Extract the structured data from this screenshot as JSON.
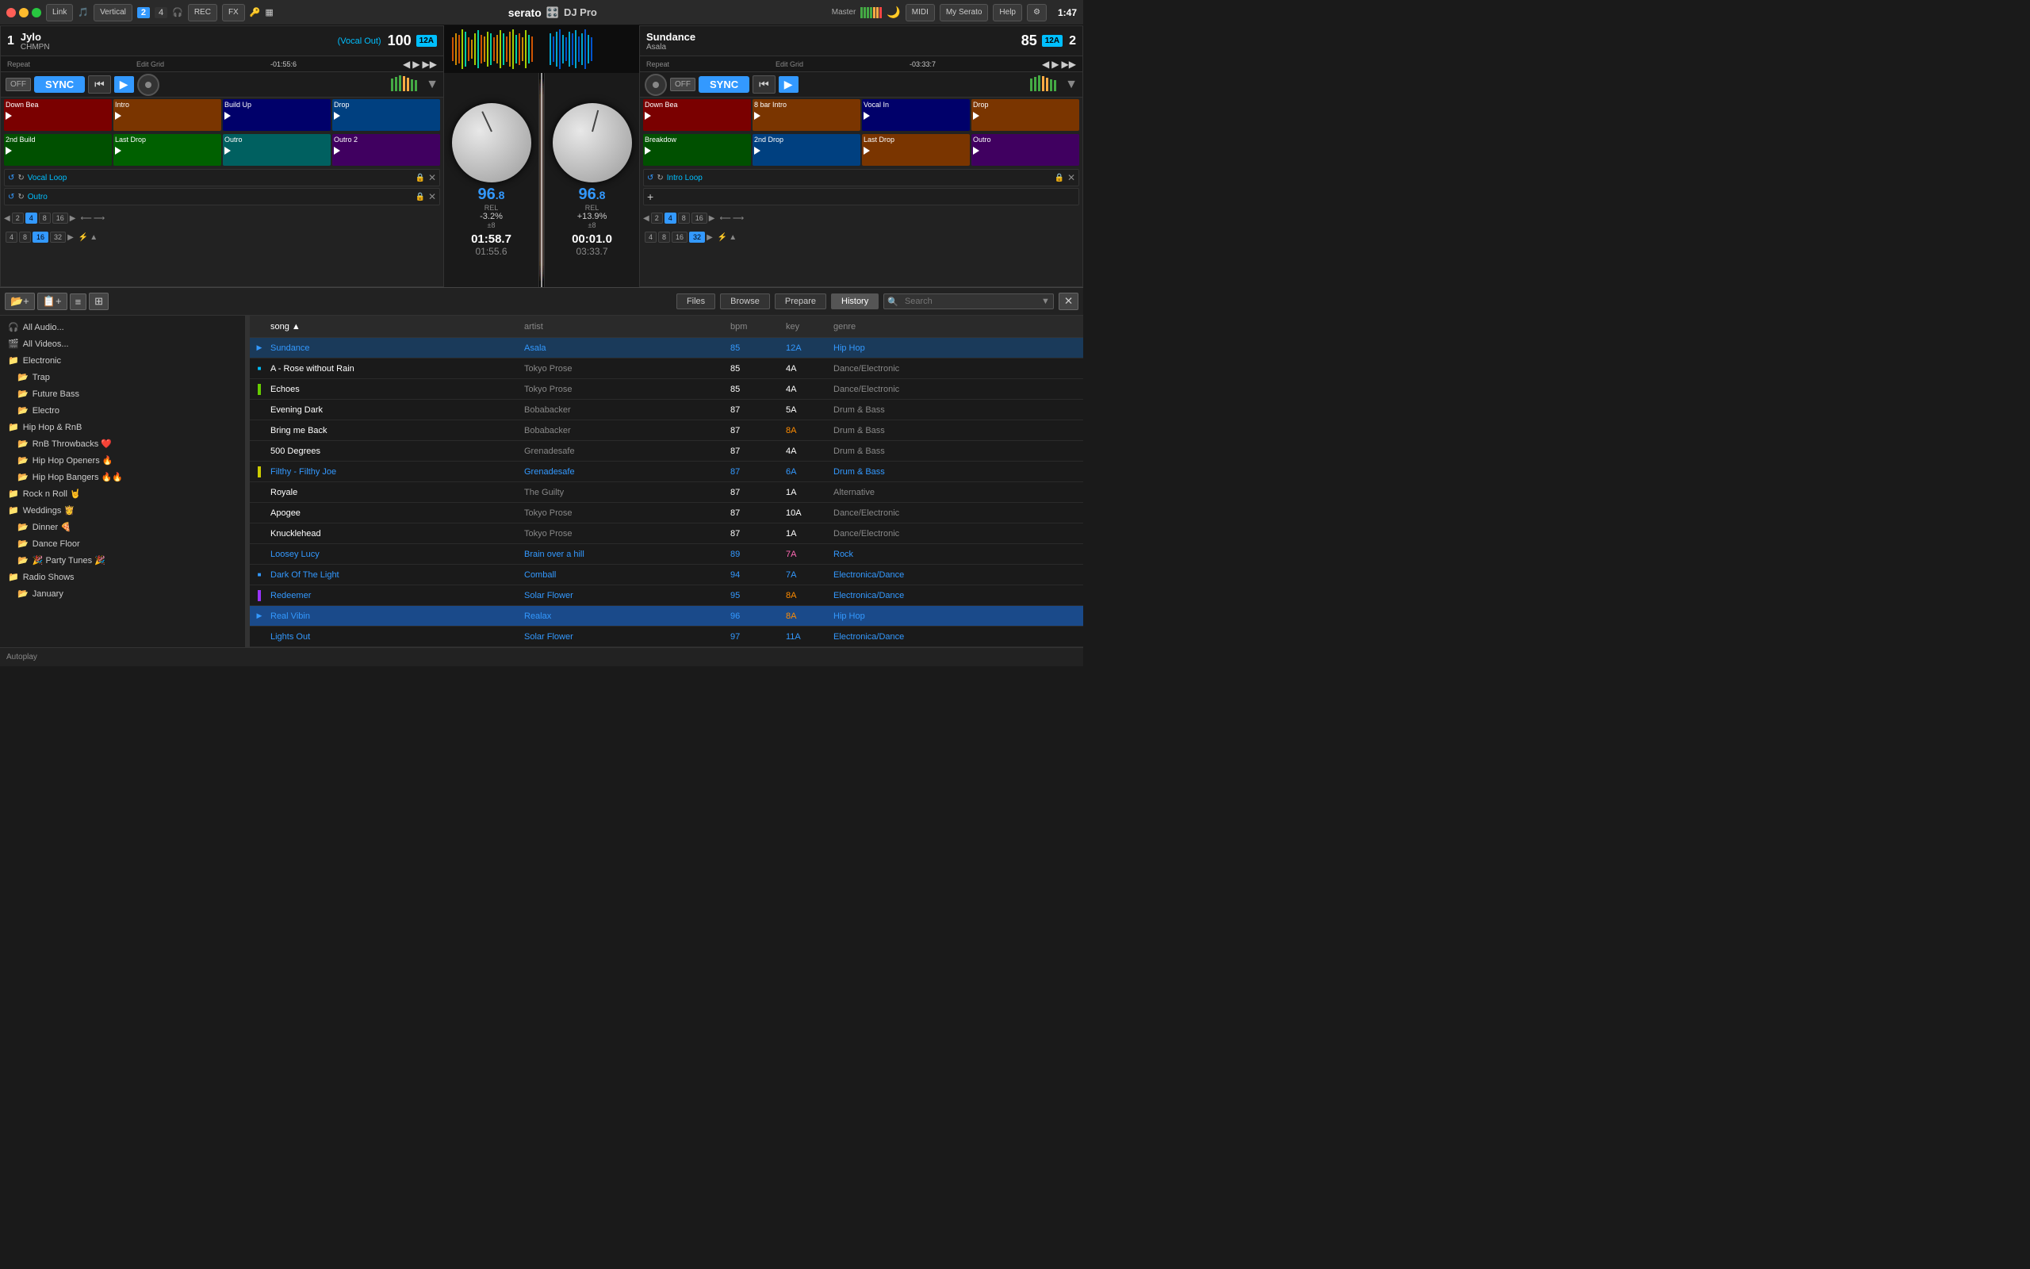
{
  "topbar": {
    "link_label": "Link",
    "vertical_label": "Vertical",
    "rec_label": "REC",
    "fx_label": "FX",
    "serato_brand": "serato",
    "dj_pro": "DJ Pro",
    "master_label": "Master",
    "midi_label": "MIDI",
    "my_serato_label": "My Serato",
    "help_label": "Help",
    "time": "1:47"
  },
  "deck1": {
    "number": "1",
    "title": "Jylo",
    "artist": "CHMPN",
    "vocal_tag": "(Vocal Out)",
    "bpm": "100",
    "key": "12A",
    "repeat_label": "Repeat",
    "edit_grid_label": "Edit Grid",
    "time_elapsed": "-01:55:6",
    "bpm_big": "96",
    "bpm_decimal": ".8",
    "bpm_rel": "REL",
    "pitch_pct": "-3.2%",
    "pitch_range": "±8",
    "time_remaining": "01:58.7",
    "time_total": "01:55.6",
    "off_label": "OFF",
    "sync_label": "SYNC",
    "cues": [
      {
        "label": "Down Bea",
        "color": "red"
      },
      {
        "label": "Intro",
        "color": "orange"
      },
      {
        "label": "Build Up",
        "color": "blue"
      },
      {
        "label": "Drop",
        "color": "blue"
      }
    ],
    "cues2": [
      {
        "label": "2nd Build",
        "color": "green"
      },
      {
        "label": "Last Drop",
        "color": "green"
      },
      {
        "label": "Outro",
        "color": "teal"
      },
      {
        "label": "Outro 2",
        "color": "purple"
      }
    ],
    "loop1_label": "Vocal Loop",
    "loop2_label": "Outro",
    "beat_vals": [
      "2",
      "4",
      "8",
      "16"
    ],
    "beat_vals2": [
      "4",
      "8",
      "16",
      "32"
    ],
    "active_beat": "4",
    "active_beat2": "16"
  },
  "deck2": {
    "number": "2",
    "title": "Sundance",
    "artist": "Asala",
    "bpm": "85",
    "key": "12A",
    "repeat_label": "Repeat",
    "edit_grid_label": "Edit Grid",
    "time_elapsed": "-03:33:7",
    "bpm_big": "96",
    "bpm_decimal": ".8",
    "bpm_rel": "REL",
    "pitch_pct": "+13.9%",
    "pitch_range": "±8",
    "time_remaining": "00:01.0",
    "time_total": "03:33.7",
    "off_label": "OFF",
    "sync_label": "SYNC",
    "cues": [
      {
        "label": "Down Bea",
        "color": "red"
      },
      {
        "label": "8 bar Intro",
        "color": "orange"
      },
      {
        "label": "Vocal In",
        "color": "blue"
      },
      {
        "label": "Drop",
        "color": "orange"
      }
    ],
    "cues2": [
      {
        "label": "Breakdow",
        "color": "green"
      },
      {
        "label": "2nd Drop",
        "color": "blue"
      },
      {
        "label": "Last Drop",
        "color": "orange"
      },
      {
        "label": "Outro",
        "color": "purple"
      }
    ],
    "loop1_label": "Intro Loop",
    "beat_vals": [
      "2",
      "4",
      "8",
      "16"
    ],
    "beat_vals2": [
      "4",
      "8",
      "16",
      "32"
    ],
    "active_beat": "4",
    "active_beat2": "32"
  },
  "library": {
    "files_tab": "Files",
    "browse_tab": "Browse",
    "prepare_tab": "Prepare",
    "history_tab": "History",
    "search_placeholder": "Search",
    "autoplay_label": "Autoplay"
  },
  "sidebar": {
    "items": [
      {
        "label": "All Audio...",
        "type": "source",
        "indent": 0
      },
      {
        "label": "All Videos...",
        "type": "source",
        "indent": 0
      },
      {
        "label": "Electronic",
        "type": "folder",
        "indent": 0
      },
      {
        "label": "Trap",
        "type": "crate",
        "indent": 1
      },
      {
        "label": "Future Bass",
        "type": "crate",
        "indent": 1
      },
      {
        "label": "Electro",
        "type": "crate",
        "indent": 1
      },
      {
        "label": "Hip Hop & RnB",
        "type": "folder",
        "indent": 0
      },
      {
        "label": "RnB Throwbacks ❤️",
        "type": "crate",
        "indent": 1
      },
      {
        "label": "Hip Hop Openers 🔥",
        "type": "crate",
        "indent": 1
      },
      {
        "label": "Hip Hop Bangers 🔥🔥",
        "type": "crate",
        "indent": 1
      },
      {
        "label": "Rock n Roll 🤘",
        "type": "folder",
        "indent": 0
      },
      {
        "label": "Weddings 👸",
        "type": "folder",
        "indent": 0
      },
      {
        "label": "Dinner 🍕",
        "type": "crate",
        "indent": 1
      },
      {
        "label": "Dance Floor",
        "type": "crate",
        "indent": 1
      },
      {
        "label": "🎉 Party Tunes 🎉",
        "type": "crate",
        "indent": 1
      },
      {
        "label": "Radio Shows",
        "type": "folder",
        "indent": 0
      },
      {
        "label": "January",
        "type": "crate",
        "indent": 1
      }
    ]
  },
  "tracks": {
    "columns": [
      "song",
      "artist",
      "bpm",
      "key",
      "genre"
    ],
    "rows": [
      {
        "song": "Sundance",
        "artist": "Asala",
        "bpm": "85",
        "key": "12A",
        "genre": "Hip Hop",
        "color": "blue",
        "indicator": "playing"
      },
      {
        "song": "A - Rose without Rain",
        "artist": "Tokyo Prose",
        "bpm": "85",
        "key": "4A",
        "genre": "Dance/Electronic",
        "color": "white",
        "indicator": "loaded"
      },
      {
        "song": "Echoes",
        "artist": "Tokyo Prose",
        "bpm": "85",
        "key": "4A",
        "genre": "Dance/Electronic",
        "color": "white",
        "indicator": "green"
      },
      {
        "song": "Evening Dark",
        "artist": "Bobabacker",
        "bpm": "87",
        "key": "5A",
        "genre": "Drum & Bass",
        "color": "white"
      },
      {
        "song": "Bring me Back",
        "artist": "Bobabacker",
        "bpm": "87",
        "key": "8A",
        "genre": "Drum & Bass",
        "color": "white",
        "key_color": "orange"
      },
      {
        "song": "500 Degrees",
        "artist": "Grenadesafe",
        "bpm": "87",
        "key": "4A",
        "genre": "Drum & Bass",
        "color": "white"
      },
      {
        "song": "Filthy - Filthy Joe",
        "artist": "Grenadesafe",
        "bpm": "87",
        "key": "6A",
        "genre": "Drum & Bass",
        "color": "blue",
        "key_color": "blue"
      },
      {
        "song": "Royale",
        "artist": "The Guilty",
        "bpm": "87",
        "key": "1A",
        "genre": "Alternative",
        "color": "white"
      },
      {
        "song": "Apogee",
        "artist": "Tokyo Prose",
        "bpm": "87",
        "key": "10A",
        "genre": "Dance/Electronic",
        "color": "white"
      },
      {
        "song": "Knucklehead",
        "artist": "Tokyo Prose",
        "bpm": "87",
        "key": "1A",
        "genre": "Dance/Electronic",
        "color": "white"
      },
      {
        "song": "Loosey Lucy",
        "artist": "Brain over a hill",
        "bpm": "89",
        "key": "7A",
        "genre": "Rock",
        "color": "blue",
        "key_color": "pink"
      },
      {
        "song": "Dark Of The Light",
        "artist": "Comball",
        "bpm": "94",
        "key": "7A",
        "genre": "Electronica/Dance",
        "color": "blue",
        "indicator": "loaded2"
      },
      {
        "song": "Redeemer",
        "artist": "Solar Flower",
        "bpm": "95",
        "key": "8A",
        "genre": "Electronica/Dance",
        "color": "blue",
        "key_color": "orange"
      },
      {
        "song": "Real Vibin",
        "artist": "Realax",
        "bpm": "96",
        "key": "8A",
        "genre": "Hip Hop",
        "color": "blue",
        "indicator": "playing2",
        "highlight": true
      },
      {
        "song": "Lights Out",
        "artist": "Solar Flower",
        "bpm": "97",
        "key": "11A",
        "genre": "Electronica/Dance",
        "color": "blue"
      }
    ]
  }
}
